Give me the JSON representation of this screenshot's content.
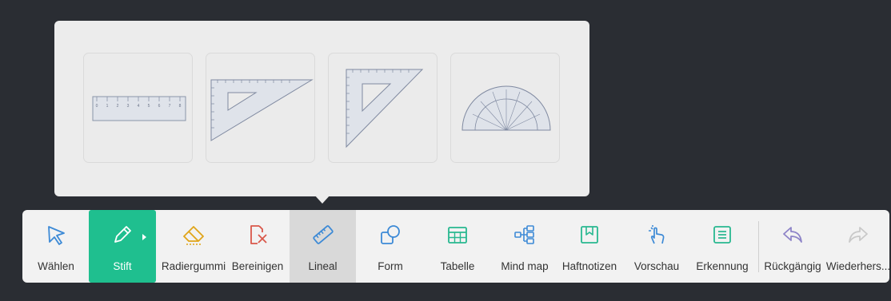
{
  "popup": {
    "tools": [
      {
        "icon": "ruler-icon"
      },
      {
        "icon": "set-square-30-60-icon"
      },
      {
        "icon": "set-square-45-icon"
      },
      {
        "icon": "protractor-icon"
      }
    ],
    "ruler_ticks": [
      "0",
      "1",
      "2",
      "3",
      "4",
      "5",
      "6",
      "7",
      "8"
    ]
  },
  "toolbar": {
    "items": [
      {
        "label": "Wählen",
        "icon": "cursor-arrow-icon"
      },
      {
        "label": "Stift",
        "icon": "pen-icon"
      },
      {
        "label": "Radiergummi",
        "icon": "eraser-icon"
      },
      {
        "label": "Bereinigen",
        "icon": "clear-page-icon"
      },
      {
        "label": "Lineal",
        "icon": "ruler-icon"
      },
      {
        "label": "Form",
        "icon": "shapes-icon"
      },
      {
        "label": "Tabelle",
        "icon": "table-icon"
      },
      {
        "label": "Mind map",
        "icon": "mind-map-icon"
      },
      {
        "label": "Haftnotizen",
        "icon": "sticky-note-icon"
      },
      {
        "label": "Vorschau",
        "icon": "touch-hand-icon"
      },
      {
        "label": "Erkennung",
        "icon": "text-recognition-icon"
      },
      {
        "label": "Rückgängig",
        "icon": "undo-icon"
      },
      {
        "label": "Wiederhers...",
        "icon": "redo-icon"
      }
    ]
  },
  "colors": {
    "accent_green": "#1fbf8f",
    "icon_blue": "#3d8ad6",
    "icon_teal": "#28b890",
    "icon_orange": "#e0a419",
    "icon_red": "#d9574a",
    "icon_purple": "#8e84c8",
    "background": "#2a2d33"
  }
}
